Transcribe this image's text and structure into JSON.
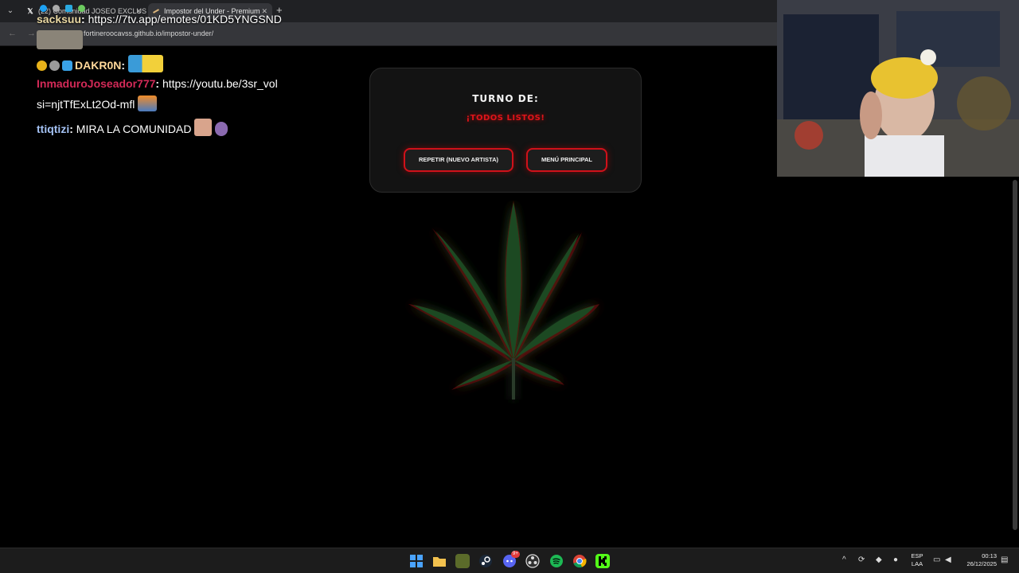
{
  "browser": {
    "tabs": [
      {
        "title": "(22) Comunidad JOSEO EXCLUS",
        "icon": "x-logo-icon"
      },
      {
        "title": "Impostor del Under - Premium",
        "icon": "joint-favicon-icon"
      }
    ],
    "close_glyph": "✕",
    "newtab_glyph": "+",
    "tab_menu_glyph": "⌄",
    "back_glyph": "←",
    "forward_glyph": "→",
    "url": "fortineroocavss.github.io/impostor-under/"
  },
  "chat": {
    "messages": [
      {
        "user": "sacksuu",
        "user_color": "#e8d7a2",
        "text": "https://7tv.app/emotes/01KD5YNGSND"
      },
      {
        "user": "DAKR0N",
        "user_color": "#ffd89a",
        "text": ""
      },
      {
        "user": "InmaduroJoseador777",
        "user_color": "#d42a58",
        "text": "https://youtu.be/3sr_vol",
        "text2": "si=njtTfExLt2Od-mfl"
      },
      {
        "user": "ttiqtizi",
        "user_color": "#a4c2f4",
        "text": "MIRA LA COMUNIDAD"
      }
    ],
    "separator": ": "
  },
  "game": {
    "turn_title": "TURNO DE:",
    "turn_status": "¡TODOS LISTOS!",
    "repeat_button": "REPETIR (NUEVO ARTISTA)",
    "menu_button": "MENÚ PRINCIPAL",
    "accent_color": "#d0111a"
  },
  "taskbar": {
    "icons": [
      "windows-start-icon",
      "file-explorer-icon",
      "folder-app-icon",
      "steam-icon",
      "discord-icon",
      "obs-icon",
      "spotify-icon",
      "chrome-icon",
      "kick-icon"
    ],
    "discord_badge": "9+",
    "lang_line1": "ESP",
    "lang_line2": "LAA",
    "time": "00:13",
    "date": "26/12/2025"
  }
}
